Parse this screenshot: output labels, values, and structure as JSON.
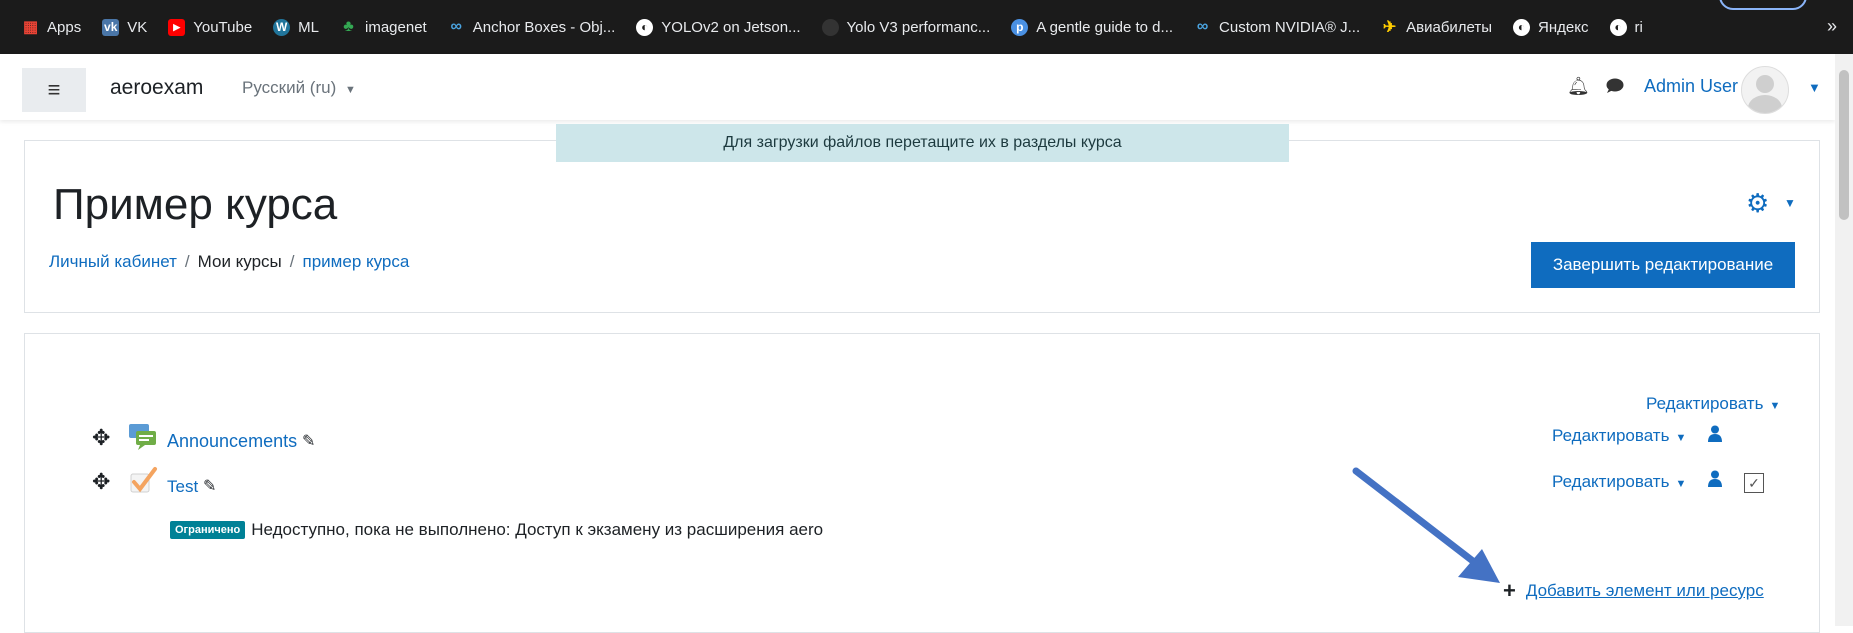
{
  "bookmarks": [
    {
      "label": "Apps",
      "icon": "apps-grid-icon",
      "color": "#ea4335"
    },
    {
      "label": "VK",
      "icon": "vk-icon",
      "color": "#4a76a8"
    },
    {
      "label": "YouTube",
      "icon": "youtube-icon",
      "color": "#ff0000"
    },
    {
      "label": "ML",
      "icon": "wordpress-icon",
      "color": "#21759b"
    },
    {
      "label": "imagenet",
      "icon": "imagenet-icon",
      "color": "#34a853"
    },
    {
      "label": "Anchor Boxes - Obj...",
      "icon": "coursera-icon",
      "color": "#4aa3df"
    },
    {
      "label": "YOLOv2 on Jetson...",
      "icon": "globe-icon",
      "color": "#ffffff"
    },
    {
      "label": "Yolo V3 performanc...",
      "icon": "github-icon",
      "color": "#333333"
    },
    {
      "label": "A gentle guide to d...",
      "icon": "p-icon",
      "color": "#4a90e2"
    },
    {
      "label": "Custom NVIDIA® J...",
      "icon": "coursera-icon",
      "color": "#4aa3df"
    },
    {
      "label": "Авиабилеты",
      "icon": "plane-icon",
      "color": "#ffcc00"
    },
    {
      "label": "Яндекс",
      "icon": "globe-icon",
      "color": "#ffffff"
    },
    {
      "label": "ri",
      "icon": "globe-icon",
      "color": "#ffffff"
    }
  ],
  "navbar": {
    "brand": "aeroexam",
    "language": "Русский (ru)",
    "username": "Admin User"
  },
  "header": {
    "drop_hint": "Для загрузки файлов перетащите их в разделы курса",
    "course_title": "Пример курса",
    "breadcrumb": [
      "Личный кабинет",
      "Мои курсы",
      "пример курса"
    ],
    "finish_button": "Завершить редактирование"
  },
  "section": {
    "edit_label": "Редактировать",
    "activities": [
      {
        "name": "Announcements",
        "icon": "forum-icon",
        "edit_label": "Редактировать"
      },
      {
        "name": "Test",
        "icon": "quiz-icon",
        "edit_label": "Редактировать"
      }
    ],
    "restriction": {
      "badge": "Ограничено",
      "text": "Недоступно, пока не выполнено: Доступ к экзамену из расширения aero"
    },
    "add_label": "Добавить элемент или ресурс"
  },
  "colors": {
    "accent": "#0f6cbf",
    "annotation_arrow": "#4472c4",
    "restricted": "#008196"
  }
}
